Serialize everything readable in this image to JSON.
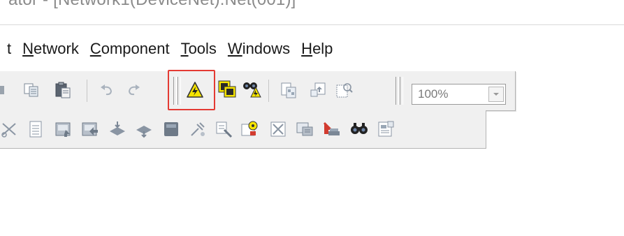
{
  "window": {
    "title": "ator - [Network1(DeviceNet).Net(001)]"
  },
  "menu": {
    "items": [
      {
        "label": "t",
        "accel": ""
      },
      {
        "label": "Network",
        "accel": "N"
      },
      {
        "label": "Component",
        "accel": "C"
      },
      {
        "label": "Tools",
        "accel": "T"
      },
      {
        "label": "Windows",
        "accel": "W"
      },
      {
        "label": "Help",
        "accel": "H"
      }
    ]
  },
  "toolbar": {
    "zoom_value": "100%",
    "highlight_color": "#e43a33",
    "icons_row1": [
      "copy-icon",
      "paste-icon",
      "undo-icon",
      "redo-icon",
      "online-icon",
      "transfer-to-network-icon",
      "monitor-network-icon",
      "compare-icon",
      "upload-icon",
      "parameter-view-icon",
      "zoom-dropdown"
    ],
    "icons_row2": [
      "cut-icon",
      "device-list-icon",
      "register-device-icon",
      "unregister-device-icon",
      "upload-device-icon",
      "download-device-icon",
      "properties-icon",
      "wire-icon",
      "parameter-wizard-icon",
      "edit-parameters-icon",
      "clear-icon",
      "monitor-icon",
      "import-icon",
      "search-icon",
      "report-icon"
    ]
  }
}
